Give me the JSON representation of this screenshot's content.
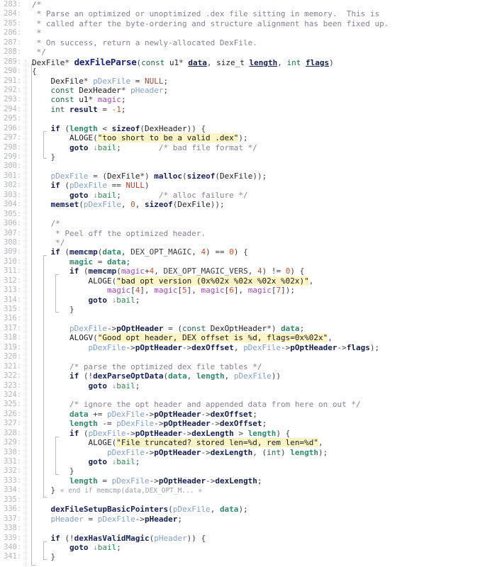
{
  "editor": {
    "language": "C",
    "first_line": 283,
    "last_line": 341,
    "colors": {
      "background": "#ffffff",
      "gutter_text": "#b3b7bb",
      "comment": "#8a7f96",
      "keyword": "#1f6b4a",
      "keyword_bold": "#13204f",
      "function": "#16215a",
      "string_highlight": "#fdf5c6",
      "number": "#c7522a",
      "macro": "#b3452e",
      "local_var": "#a048b8",
      "pointer_var": "#7fa0cf",
      "param_var": "#2f8a6e",
      "label": "#2f8a4a",
      "indent_guide": "#cfd3d7"
    },
    "fold_note_line": 334,
    "fold_note_text": "« end if memcmp(data,DEX_OPT_M... »",
    "jump_marker_glyph": "↓"
  },
  "lines": [
    {
      "n": 283,
      "text": "/*"
    },
    {
      "n": 284,
      "text": " * Parse an optimized or unoptimized .dex file sitting in memory.  This is"
    },
    {
      "n": 285,
      "text": " * called after the byte-ordering and structure alignment has been fixed up."
    },
    {
      "n": 286,
      "text": " *"
    },
    {
      "n": 287,
      "text": " * On success, return a newly-allocated DexFile."
    },
    {
      "n": 288,
      "text": " */"
    },
    {
      "n": 289,
      "text": "DexFile* dexFileParse(const u1* data, size_t length, int flags)"
    },
    {
      "n": 290,
      "text": "{"
    },
    {
      "n": 291,
      "text": "    DexFile* pDexFile = NULL;"
    },
    {
      "n": 292,
      "text": "    const DexHeader* pHeader;"
    },
    {
      "n": 293,
      "text": "    const u1* magic;"
    },
    {
      "n": 294,
      "text": "    int result = -1;"
    },
    {
      "n": 295,
      "text": ""
    },
    {
      "n": 296,
      "text": "    if (length < sizeof(DexHeader)) {"
    },
    {
      "n": 297,
      "text": "        ALOGE(\"too short to be a valid .dex\");"
    },
    {
      "n": 298,
      "text": "        goto bail;        /* bad file format */"
    },
    {
      "n": 299,
      "text": "    }"
    },
    {
      "n": 300,
      "text": ""
    },
    {
      "n": 301,
      "text": "    pDexFile = (DexFile*) malloc(sizeof(DexFile));"
    },
    {
      "n": 302,
      "text": "    if (pDexFile == NULL)"
    },
    {
      "n": 303,
      "text": "        goto bail;        /* alloc failure */"
    },
    {
      "n": 304,
      "text": "    memset(pDexFile, 0, sizeof(DexFile));"
    },
    {
      "n": 305,
      "text": ""
    },
    {
      "n": 306,
      "text": "    /*"
    },
    {
      "n": 307,
      "text": "     * Peel off the optimized header."
    },
    {
      "n": 308,
      "text": "     */"
    },
    {
      "n": 309,
      "text": "    if (memcmp(data, DEX_OPT_MAGIC, 4) == 0) {"
    },
    {
      "n": 310,
      "text": "        magic = data;"
    },
    {
      "n": 311,
      "text": "        if (memcmp(magic+4, DEX_OPT_MAGIC_VERS, 4) != 0) {"
    },
    {
      "n": 312,
      "text": "            ALOGE(\"bad opt version (0x%02x %02x %02x %02x)\","
    },
    {
      "n": 313,
      "text": "                magic[4], magic[5], magic[6], magic[7]);"
    },
    {
      "n": 314,
      "text": "            goto bail;"
    },
    {
      "n": 315,
      "text": "        }"
    },
    {
      "n": 316,
      "text": ""
    },
    {
      "n": 317,
      "text": "        pDexFile->pOptHeader = (const DexOptHeader*) data;"
    },
    {
      "n": 318,
      "text": "        ALOGV(\"Good opt header, DEX offset is %d, flags=0x%02x\","
    },
    {
      "n": 319,
      "text": "            pDexFile->pOptHeader->dexOffset, pDexFile->pOptHeader->flags);"
    },
    {
      "n": 320,
      "text": ""
    },
    {
      "n": 321,
      "text": "        /* parse the optimized dex file tables */"
    },
    {
      "n": 322,
      "text": "        if (!dexParseOptData(data, length, pDexFile))"
    },
    {
      "n": 323,
      "text": "            goto bail;"
    },
    {
      "n": 324,
      "text": ""
    },
    {
      "n": 325,
      "text": "        /* ignore the opt header and appended data from here on out */"
    },
    {
      "n": 326,
      "text": "        data += pDexFile->pOptHeader->dexOffset;"
    },
    {
      "n": 327,
      "text": "        length -= pDexFile->pOptHeader->dexOffset;"
    },
    {
      "n": 328,
      "text": "        if (pDexFile->pOptHeader->dexLength > length) {"
    },
    {
      "n": 329,
      "text": "            ALOGE(\"File truncated? stored len=%d, rem len=%d\","
    },
    {
      "n": 330,
      "text": "                pDexFile->pOptHeader->dexLength, (int) length);"
    },
    {
      "n": 331,
      "text": "            goto bail;"
    },
    {
      "n": 332,
      "text": "        }"
    },
    {
      "n": 333,
      "text": "        length = pDexFile->pOptHeader->dexLength;"
    },
    {
      "n": 334,
      "text": "    } « end if memcmp(data,DEX_OPT_M... »"
    },
    {
      "n": 335,
      "text": ""
    },
    {
      "n": 336,
      "text": "    dexFileSetupBasicPointers(pDexFile, data);"
    },
    {
      "n": 337,
      "text": "    pHeader = pDexFile->pHeader;"
    },
    {
      "n": 338,
      "text": ""
    },
    {
      "n": 339,
      "text": "    if (!dexHasValidMagic(pHeader)) {"
    },
    {
      "n": 340,
      "text": "        goto bail;"
    },
    {
      "n": 341,
      "text": "    }"
    }
  ]
}
